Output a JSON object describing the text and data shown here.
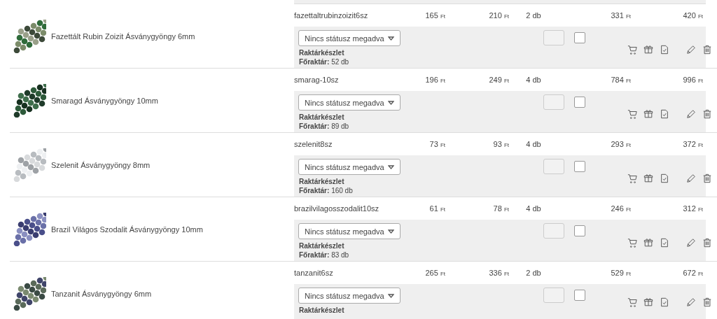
{
  "products": [
    {
      "name": "Fazettált Rubin Zoizit Ásványgyöngy 6mm",
      "sku": "fazettaltrubinzoizit6sz",
      "unit_price_net": {
        "value": "165",
        "unit": "Ft"
      },
      "unit_price_gross": {
        "value": "210",
        "unit": "Ft"
      },
      "quantity": "2 db",
      "total_net": {
        "value": "331",
        "unit": "Ft"
      },
      "total_gross": {
        "value": "420",
        "unit": "Ft"
      },
      "status": "Nincs státusz megadva",
      "checked": false,
      "stock_title": "Raktárkészlet",
      "stock_label": "Főraktár:",
      "stock_value": "52 db"
    },
    {
      "name": "Smaragd Ásványgyöngy 10mm",
      "sku": "smarag-10sz",
      "unit_price_net": {
        "value": "196",
        "unit": "Ft"
      },
      "unit_price_gross": {
        "value": "249",
        "unit": "Ft"
      },
      "quantity": "4 db",
      "total_net": {
        "value": "784",
        "unit": "Ft"
      },
      "total_gross": {
        "value": "996",
        "unit": "Ft"
      },
      "status": "Nincs státusz megadva",
      "checked": false,
      "stock_title": "Raktárkészlet",
      "stock_label": "Főraktár:",
      "stock_value": "89 db"
    },
    {
      "name": "Szelenit Ásványgyöngy 8mm",
      "sku": "szelenit8sz",
      "unit_price_net": {
        "value": "73",
        "unit": "Ft"
      },
      "unit_price_gross": {
        "value": "93",
        "unit": "Ft"
      },
      "quantity": "4 db",
      "total_net": {
        "value": "293",
        "unit": "Ft"
      },
      "total_gross": {
        "value": "372",
        "unit": "Ft"
      },
      "status": "Nincs státusz megadva",
      "checked": false,
      "stock_title": "Raktárkészlet",
      "stock_label": "Főraktár:",
      "stock_value": "160 db"
    },
    {
      "name": "Brazil Világos Szodalit Ásványgyöngy 10mm",
      "sku": "brazilvilagosszodalit10sz",
      "unit_price_net": {
        "value": "61",
        "unit": "Ft"
      },
      "unit_price_gross": {
        "value": "78",
        "unit": "Ft"
      },
      "quantity": "4 db",
      "total_net": {
        "value": "246",
        "unit": "Ft"
      },
      "total_gross": {
        "value": "312",
        "unit": "Ft"
      },
      "status": "Nincs státusz megadva",
      "checked": false,
      "stock_title": "Raktárkészlet",
      "stock_label": "Főraktár:",
      "stock_value": "83 db"
    },
    {
      "name": "Tanzanit Ásványgyöngy 6mm",
      "sku": "tanzanit6sz",
      "unit_price_net": {
        "value": "265",
        "unit": "Ft"
      },
      "unit_price_gross": {
        "value": "336",
        "unit": "Ft"
      },
      "quantity": "2 db",
      "total_net": {
        "value": "529",
        "unit": "Ft"
      },
      "total_gross": {
        "value": "672",
        "unit": "Ft"
      },
      "status": "Nincs státusz megadva",
      "checked": false,
      "stock_title": "Raktárkészlet"
    }
  ]
}
